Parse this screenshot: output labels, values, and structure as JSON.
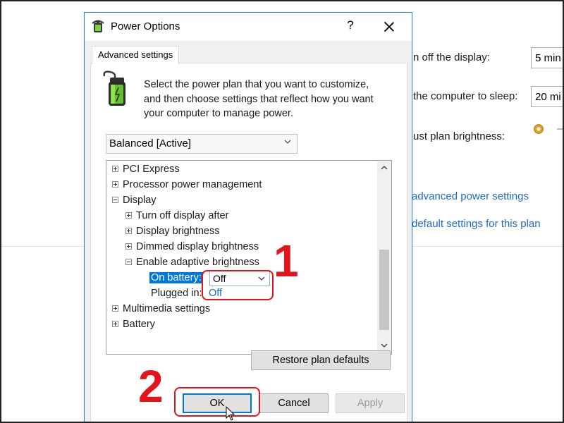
{
  "background": {
    "rows": [
      {
        "label": "n off the display:",
        "value": "5 min"
      },
      {
        "label": "the computer to sleep:",
        "value": "20 mi"
      },
      {
        "label": "ust plan brightness:"
      }
    ],
    "links": {
      "advanced": "advanced power settings",
      "restore": "default settings for this plan"
    }
  },
  "dialog": {
    "title": "Power Options",
    "help_label": "?",
    "tab_label": "Advanced settings",
    "intro_lines": [
      "Select the power plan that you want to customize,",
      "and then choose settings that reflect how you want",
      "your computer to manage power."
    ],
    "plan_selected": "Balanced [Active]",
    "tree": {
      "pci_express": "PCI Express",
      "processor": "Processor power management",
      "display": "Display",
      "turn_off_display": "Turn off display after",
      "display_brightness": "Display brightness",
      "dimmed_brightness": "Dimmed display brightness",
      "adaptive_brightness": "Enable adaptive brightness",
      "on_battery_label": "On battery:",
      "on_battery_value": "Off",
      "plugged_in_label": "Plugged in:",
      "plugged_in_value": "Off",
      "multimedia": "Multimedia settings",
      "battery": "Battery"
    },
    "restore_button": "Restore plan defaults",
    "ok_button": "OK",
    "cancel_button": "Cancel",
    "apply_button": "Apply"
  },
  "annotations": {
    "step1": "1",
    "step2": "2"
  },
  "colors": {
    "accent": "#0078d7",
    "link": "#1e69c8",
    "annotation": "#e4141b"
  }
}
